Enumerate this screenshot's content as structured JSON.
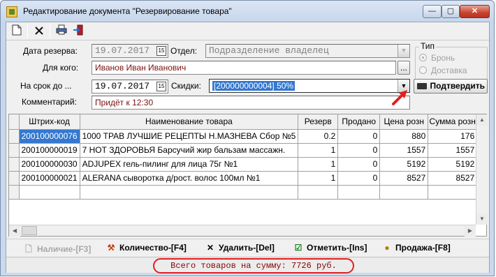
{
  "window": {
    "title": "Редактирование документа  \"Резервирование товара\"",
    "controls": {
      "minimize": "—",
      "maximize": "▢",
      "close": "✕"
    }
  },
  "toolbar": {
    "items": [
      {
        "name": "new-document-icon",
        "glyph": "🗋"
      },
      {
        "name": "delete-icon",
        "glyph": "✕"
      },
      {
        "name": "print-icon",
        "glyph": "🖶"
      },
      {
        "name": "exit-icon",
        "glyph": "⇥"
      }
    ]
  },
  "form": {
    "reserve_date_label": "Дата резерва:",
    "reserve_date_value": "19.07.2017",
    "department_label": "Отдел:",
    "department_value": "Подразделение владелец",
    "for_whom_label": "Для кого:",
    "for_whom_value": "Иванов Иван Иванович",
    "ellipsis_button": "...",
    "due_date_label": "На срок до ...",
    "due_date_value": "19.07.2017",
    "calendar_glyph": "15",
    "discounts_label": "Скидки:",
    "discounts_value": "[200000000004] 50%",
    "comment_label": "Комментарий:",
    "comment_value": "Придёт к 12:30",
    "confirm_button": "Подтвердить",
    "type_group": {
      "title": "Тип",
      "options": [
        "Бронь",
        "Доставка"
      ],
      "selected": "Бронь"
    }
  },
  "grid": {
    "columns": [
      "Штрих-код",
      "Наименование товара",
      "Резерв",
      "Продано",
      "Цена розн",
      "Сумма розн"
    ],
    "rows": [
      [
        "200100000076",
        "1000 ТРАВ ЛУЧШИЕ РЕЦЕПТЫ Н.МАЗНЕВА Сбор №5",
        "0.2",
        "0",
        "880",
        "176"
      ],
      [
        "200100000019",
        "7 НОТ ЗДОРОВЬЯ Барсучий жир бальзам массажн.",
        "1",
        "0",
        "1557",
        "1557"
      ],
      [
        "200100000030",
        "ADJUPEX гель-пилинг для лица 75г №1",
        "1",
        "0",
        "5192",
        "5192"
      ],
      [
        "200100000021",
        "ALERANA сыворотка д/рост. волос 100мл №1",
        "1",
        "0",
        "8527",
        "8527"
      ]
    ],
    "selected_cell": "200100000076"
  },
  "actions": {
    "availability": "Наличие-[F3]",
    "quantity": "Количество-[F4]",
    "delete": "Удалить-[Del]",
    "mark": "Отметить-[Ins]",
    "sale": "Продажа-[F8]"
  },
  "status": {
    "total": "Всего товаров на сумму: 7726 руб."
  },
  "colors": {
    "selection": "#3478d0",
    "annotation_red": "#e02020",
    "comment_text": "#7a1010"
  }
}
